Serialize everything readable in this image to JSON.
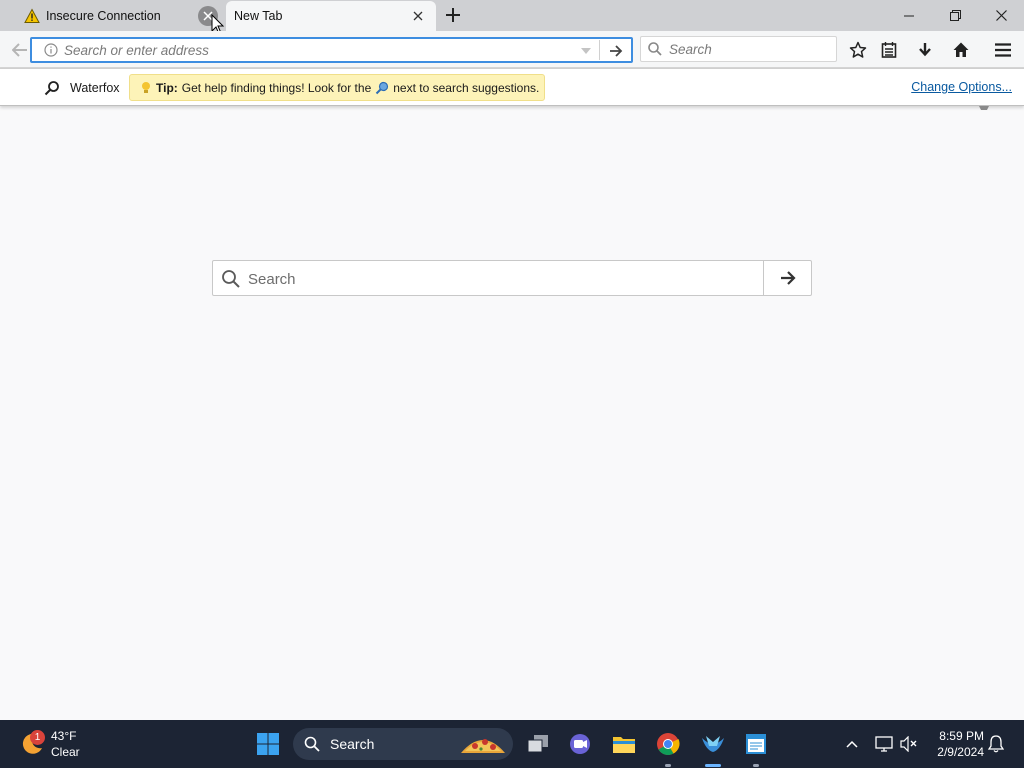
{
  "browser": {
    "tabs": [
      {
        "title": "Insecure Connection",
        "icon": "warning-icon",
        "active": false
      },
      {
        "title": "New Tab",
        "icon": "none",
        "active": true
      }
    ]
  },
  "navbar": {
    "url_placeholder": "Search or enter address",
    "search_placeholder": "Search"
  },
  "tipbar": {
    "engine_label": "Waterfox",
    "tip_bold": "Tip:",
    "tip_text_before": "Get help finding things! Look for the",
    "tip_text_after": "next to search suggestions.",
    "change_options": "Change Options..."
  },
  "content": {
    "search_placeholder": "Search"
  },
  "taskbar": {
    "weather": {
      "badge": "1",
      "temp": "43°F",
      "condition": "Clear"
    },
    "search_label": "Search",
    "apps": [
      "task-view",
      "teams-meet",
      "file-explorer",
      "chrome",
      "waterfox",
      "notepad"
    ],
    "clock": {
      "time": "8:59 PM",
      "date": "2/9/2024"
    }
  },
  "colors": {
    "accent": "#3d8de0",
    "tip_bg": "#fdf3b8",
    "taskbar_bg": "#1c2434",
    "link": "#0a5aa0"
  }
}
